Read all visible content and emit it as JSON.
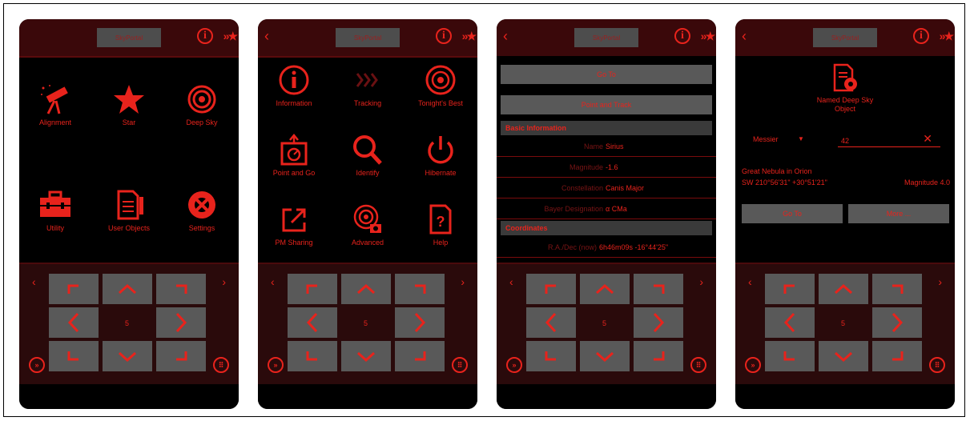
{
  "common": {
    "title_button": "SkyPortal",
    "speed_value": "5",
    "nav_left": "‹",
    "nav_right": "›"
  },
  "screen1": {
    "items": [
      {
        "label": "Alignment",
        "icon": "telescope-icon"
      },
      {
        "label": "Star",
        "icon": "star-icon"
      },
      {
        "label": "Deep Sky",
        "icon": "galaxy-icon"
      },
      {
        "label": "Utility",
        "icon": "toolbox-icon"
      },
      {
        "label": "User Objects",
        "icon": "user-objects-icon"
      },
      {
        "label": "Settings",
        "icon": "settings-icon"
      }
    ]
  },
  "screen2": {
    "items": [
      {
        "label": "Information",
        "icon": "info-icon"
      },
      {
        "label": "Tracking",
        "icon": "tracking-icon"
      },
      {
        "label": "Tonight's Best",
        "icon": "tonights-best-icon"
      },
      {
        "label": "Point and Go",
        "icon": "point-and-go-icon"
      },
      {
        "label": "Identify",
        "icon": "magnifier-icon"
      },
      {
        "label": "Hibernate",
        "icon": "power-icon"
      },
      {
        "label": "PM Sharing",
        "icon": "share-icon"
      },
      {
        "label": "Advanced",
        "icon": "advanced-icon"
      },
      {
        "label": "Help",
        "icon": "help-icon"
      }
    ]
  },
  "screen3": {
    "goto_label": "Go To",
    "point_track_label": "Point and Track",
    "basic_info_header": "Basic Information",
    "rows": [
      {
        "key": "Name",
        "value": "Sirius"
      },
      {
        "key": "Magnitude",
        "value": "-1.6"
      },
      {
        "key": "Constellation",
        "value": "Canis Major"
      },
      {
        "key": "Bayer Designation",
        "value": "α CMa"
      }
    ],
    "coords_header": "Coordinates",
    "coord_row": {
      "key": "R.A./Dec (now)",
      "value": "6h46m09s -16°44'25\""
    }
  },
  "screen4": {
    "category_label": "Named Deep Sky Object",
    "catalog_select": "Messier",
    "search_value": "42",
    "object_name": "Great Nebula in Orion",
    "position": "SW 210°56'31\" +30°51'21\"",
    "magnitude": "Magnitude 4.0",
    "goto_label": "Go To",
    "more_label": "More ..."
  },
  "colors": {
    "accent": "#e8231c",
    "topbar": "#3a080a",
    "button_gray": "#595959",
    "pad_bg": "#2a0a0b"
  }
}
